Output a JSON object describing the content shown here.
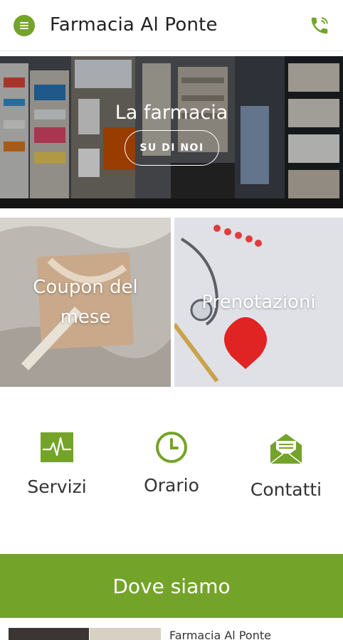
{
  "header": {
    "title": "Farmacia Al Ponte",
    "menu_icon": "hamburger-menu-icon",
    "phone_icon": "phone-icon"
  },
  "hero": {
    "title": "La farmacia",
    "button_label": "SU DI NOI"
  },
  "tiles": [
    {
      "label_line1": "Coupon del",
      "label_line2": "mese"
    },
    {
      "label": "Prenotazioni"
    }
  ],
  "quick_links": [
    {
      "label": "Servizi",
      "icon": "heartbeat-icon"
    },
    {
      "label": "Orario",
      "icon": "clock-icon"
    },
    {
      "label": "Contatti",
      "icon": "envelope-icon"
    }
  ],
  "location": {
    "button_label": "Dove siamo",
    "preview_title": "Farmacia Al Ponte"
  },
  "colors": {
    "accent": "#74a32a",
    "header_text": "#222222",
    "white": "#ffffff"
  }
}
